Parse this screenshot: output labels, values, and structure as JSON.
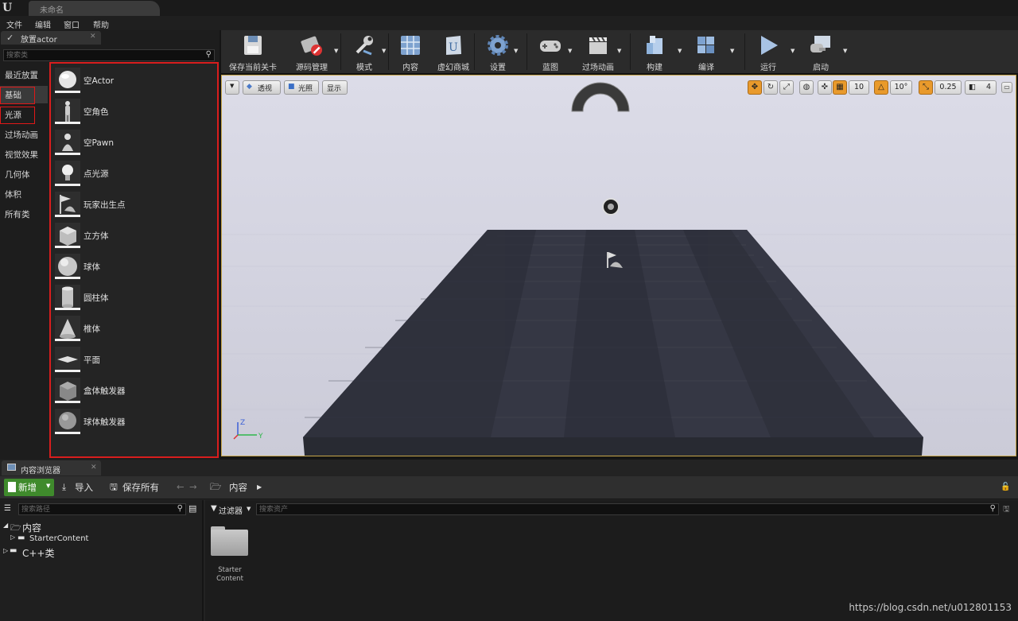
{
  "window": {
    "tab_title": "未命名"
  },
  "menu": [
    "文件",
    "编辑",
    "窗口",
    "帮助"
  ],
  "place_panel": {
    "tab_label": "放置actor",
    "search_placeholder": "搜索类",
    "categories": [
      "最近放置",
      "基础",
      "光源",
      "过场动画",
      "视觉效果",
      "几何体",
      "体积",
      "所有类"
    ],
    "actors": [
      "空Actor",
      "空角色",
      "空Pawn",
      "点光源",
      "玩家出生点",
      "立方体",
      "球体",
      "圆柱体",
      "椎体",
      "平面",
      "盒体触发器",
      "球体触发器"
    ]
  },
  "toolbar": {
    "buttons": [
      "保存当前关卡",
      "源码管理",
      "模式",
      "内容",
      "虚幻商城",
      "设置",
      "蓝图",
      "过场动画",
      "构建",
      "编译",
      "运行",
      "启动"
    ]
  },
  "viewport": {
    "left_buttons": [
      "透视",
      "光照",
      "显示"
    ],
    "grid_snap": "10",
    "rotation_snap": "10°",
    "scale_snap": "0.25",
    "camera_speed": "4"
  },
  "content_browser": {
    "tab_label": "内容浏览器",
    "new_label": "新增",
    "import_label": "导入",
    "save_all_label": "保存所有",
    "path_root": "内容",
    "path_search_placeholder": "搜索路径",
    "filter_label": "过滤器",
    "asset_search_placeholder": "搜索资产",
    "tree": [
      "内容",
      "StarterContent",
      "C++类"
    ],
    "folder_line1": "Starter",
    "folder_line2": "Content"
  },
  "watermark": "https://blog.csdn.net/u012801153",
  "colors": {
    "highlight_red": "#d81d1d",
    "new_button_green": "#3f8a2c",
    "snap_orange": "#e99a2c"
  }
}
